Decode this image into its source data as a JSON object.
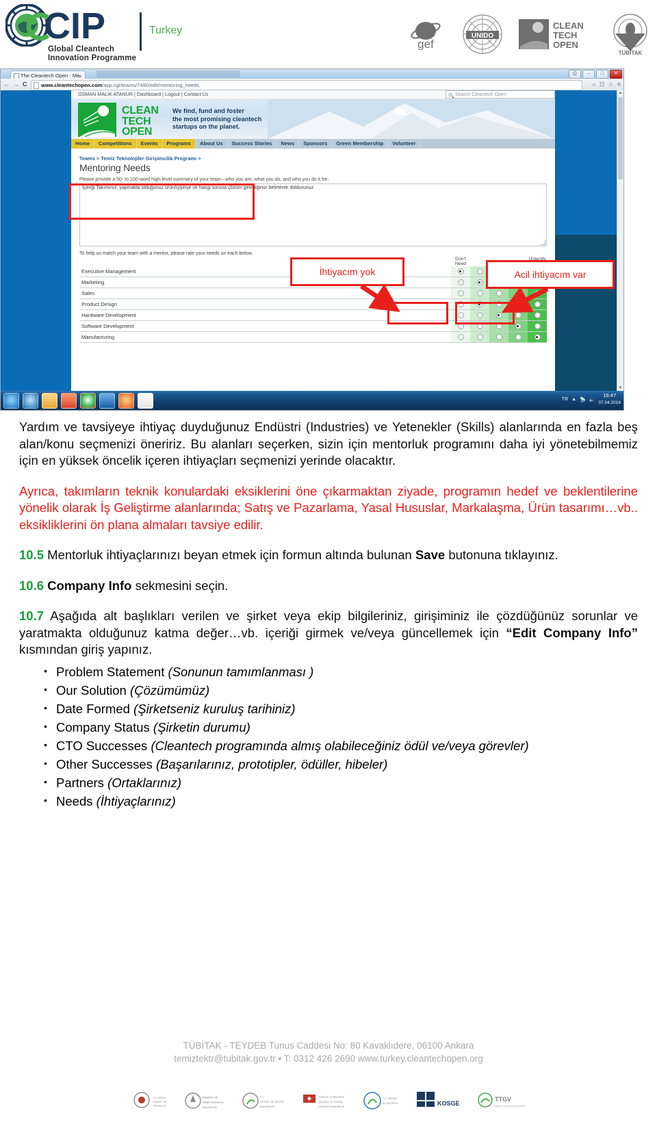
{
  "header": {
    "brand": {
      "acronym": "GCIP",
      "subtitle_line1": "Global Cleantech",
      "subtitle_line2": "Innovation Programme",
      "country": "Turkey"
    },
    "partners": [
      {
        "name": "gef",
        "label": "gef"
      },
      {
        "name": "unido",
        "label": "UNIDO"
      },
      {
        "name": "cleantech-open",
        "label": "CLEAN TECH OPEN"
      },
      {
        "name": "tubitak",
        "label": "TÜBİTAK"
      }
    ]
  },
  "screenshot": {
    "browser": {
      "tab_title": "The Cleantech Open - Me",
      "url_domain": "www.cleantechopen.com",
      "url_path": "/app.cgi/teams/7490/edit/mentoring_needs",
      "back_icon": "back-arrow-icon",
      "forward_icon": "forward-arrow-icon",
      "reload_icon": "C",
      "zoom_icon": "magnifier-icon",
      "extension_icon": "extension-icon",
      "bookmark_icon": "star-icon",
      "menu_icon": "≡",
      "minimize_label": "–",
      "maximize_label": "□",
      "close_label": "✕",
      "print_label": "⎙"
    },
    "site": {
      "utility_bar": "OSMAN MALİK ATANUR | Dashboard | Logout | Contact Us",
      "search_placeholder": "Search Cleantech Open",
      "logo_line1": "CLEAN",
      "logo_line2": "TECH",
      "logo_line3": "OPEN",
      "tagline_line1": "We find, fund and foster",
      "tagline_line2": "the most promising cleantech",
      "tagline_line3": "startups on the planet.",
      "nav": [
        {
          "label": "Home",
          "highlighted": true
        },
        {
          "label": "Competitions",
          "highlighted": true
        },
        {
          "label": "Events",
          "highlighted": true
        },
        {
          "label": "Programs",
          "highlighted": true
        },
        {
          "label": "About Us",
          "highlighted": false
        },
        {
          "label": "Success Stories",
          "highlighted": false
        },
        {
          "label": "News",
          "highlighted": false
        },
        {
          "label": "Sponsors",
          "highlighted": false
        },
        {
          "label": "Green Membership",
          "highlighted": false
        },
        {
          "label": "Volunteer",
          "highlighted": false
        }
      ],
      "breadcrumb": "Teams > Temiz Teknolojiler Girişimcilik Programı >",
      "page_title": "Mentoring Needs",
      "summary_help": "Please provide a 50- to 100-word high-level summary of your team—who you are, what you do, and who you do it for:",
      "summary_value": "İçeriği Takımınız, yapmakta olduğunuz ürün/iş/proje ve hangi soruna çözüm getirdiğinizi belirterek doldurunuz.",
      "rate_help": "To help us match your team with a mentor, please rate your needs on each below.",
      "col_left_header": "Don't Need",
      "col_right_header": "Urgently Need",
      "rows": [
        {
          "label": "Executive Management",
          "selected": 1
        },
        {
          "label": "Marketing",
          "selected": 2
        },
        {
          "label": "Sales",
          "selected": 0
        },
        {
          "label": "Product Design",
          "selected": 2
        },
        {
          "label": "Hardware Development",
          "selected": 3
        },
        {
          "label": "Software Development",
          "selected": 4
        },
        {
          "label": "Manufacturing",
          "selected": 5
        }
      ]
    },
    "taskbar": {
      "language": "TR",
      "time": "16:47",
      "date": "07.04.2016"
    },
    "callouts": [
      {
        "name": "callout-no-need",
        "text": "İhtiyacım yok"
      },
      {
        "name": "callout-urgent-need",
        "text": "Acil ihtiyacım var"
      }
    ]
  },
  "body": {
    "paragraph_1": "Yardım ve tavsiyeye ihtiyaç duyduğunuz Endüstri (Industries) ve Yetenekler (Skills) alanlarında en fazla beş alan/konu seçmenizi öneririz. Bu alanları seçerken, sizin için mentorluk programını daha iyi yönetebilmemiz için en yüksek öncelik içeren ihtiyaçları seçmenizi yerinde olacaktır.",
    "paragraph_2": "Ayrıca, takımların teknik konulardaki eksiklerini öne çıkarmaktan ziyade, programın hedef ve beklentilerine yönelik olarak İş Geliştirme alanlarında; Satış ve Pazarlama, Yasal Hususlar, Markalaşma, Ürün tasarımı…vb.. eksikliklerini ön plana almaları tavsiye edilir.",
    "step_10_5": {
      "number": "10.5",
      "text_before": " Mentorluk ihtiyaçlarınızı beyan etmek için formun altında bulunan ",
      "bold": "Save",
      "text_after": " butonuna tıklayınız."
    },
    "step_10_6": {
      "number": "10.6",
      "text_before": " ",
      "bold": "Company Info",
      "text_after": " sekmesini seçin."
    },
    "step_10_7": {
      "number": "10.7",
      "text_before": " Aşağıda alt başlıkları verilen ve şirket veya ekip bilgileriniz, girişiminiz ile çözdüğünüz sorunlar ve yaratmakta olduğunuz katma değer…vb. içeriği girmek ve/veya güncellemek için ",
      "bold": "“Edit Company Info”",
      "text_after": " kısmından giriş yapınız."
    },
    "bullets": [
      {
        "en": "Problem Statement",
        "tr": "(Sonunun tamımlanması )"
      },
      {
        "en": "Our Solution",
        "tr": "(Çözümümüz)"
      },
      {
        "en": "Date Formed",
        "tr": "(Şirketseniz kuruluş tarihiniz)"
      },
      {
        "en": "Company Status",
        "tr": "(Şirketin durumu)"
      },
      {
        "en": "CTO Successes",
        "tr": "(Cleantech programında almış olabileceğiniz ödül ve/veya görevler)"
      },
      {
        "en": "Other Successes",
        "tr": "(Başarılarınız, prototipler, ödüller, hibeler)"
      },
      {
        "en": "Partners",
        "tr": "(Ortaklarınız)"
      },
      {
        "en": "Needs",
        "tr": "(İhtiyaçlarınız)"
      }
    ]
  },
  "footer": {
    "line1": "TÜBİTAK - TEYDEB Tunus Caddesi No: 80 Kavaklıdere, 06100 Ankara",
    "line2": "temiztektr@tubitak.gov.tr • T:  0312 426 2690 www.turkey.cleantechopen.org",
    "logos": [
      {
        "name": "enerji-tabii-kaynaklar",
        "label": "T.C. BİLİM, SANAYİ VE TEKNOLOJİ BAKANLIĞI"
      },
      {
        "name": "enerji-bakanligi",
        "label": "ENERJİ VE TABİİ KAYNAKLAR BAKANLIĞI"
      },
      {
        "name": "cevre-sehircilik",
        "label": "T.C. ÇEVRE VE ŞEHİRCİLİK BAKANLIĞI"
      },
      {
        "name": "calisma-sosyal-guvenlik",
        "label": "T.C. ÇALIŞMA VE SOSYAL GÜVENLİK BAKANLIĞI"
      },
      {
        "name": "orman-su-isleri",
        "label": "T.C. ORMAN VE SU İŞLERİ BAKANLIĞI"
      },
      {
        "name": "kosgeb",
        "label": "KOSGEB"
      },
      {
        "name": "ttgv",
        "label": "TTGV"
      }
    ]
  },
  "colors": {
    "accent_red": "#e8201a",
    "accent_green": "#1a9c3c",
    "brand_blue": "#1b3a5c",
    "cto_green": "#17a637"
  }
}
